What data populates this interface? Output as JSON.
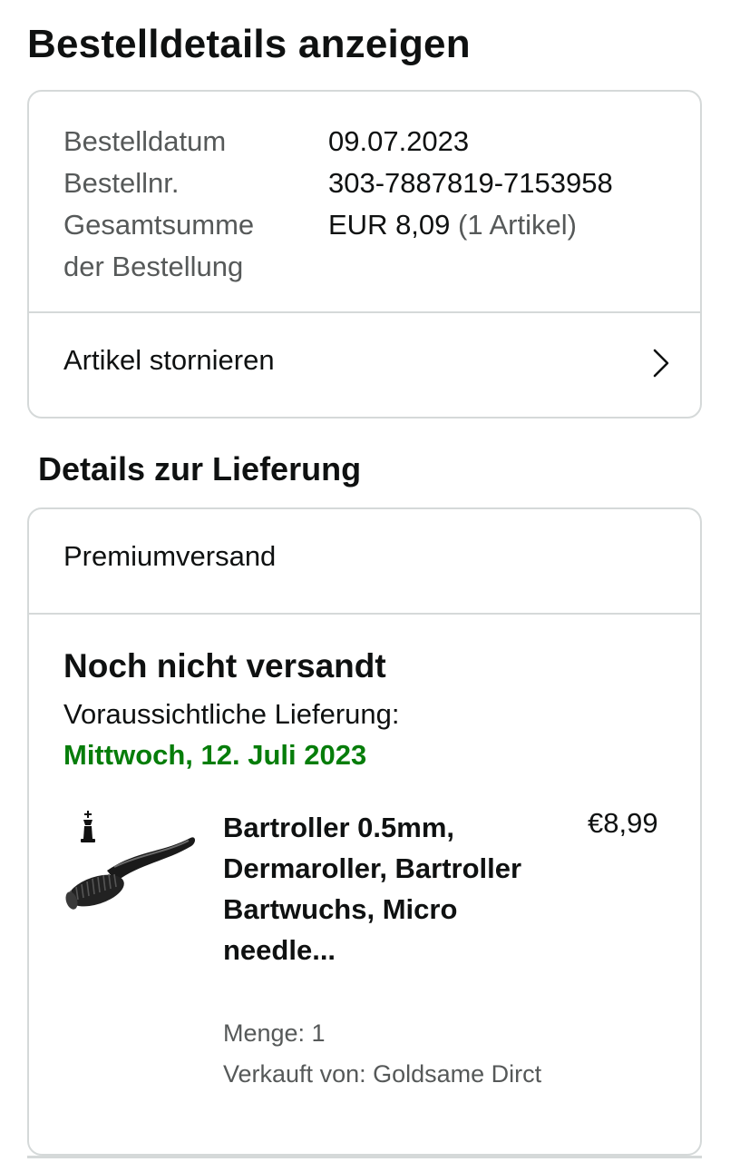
{
  "page": {
    "title": "Bestelldetails anzeigen"
  },
  "order": {
    "date_label": "Bestelldatum",
    "date_value": "09.07.2023",
    "number_label": "Bestellnr.",
    "number_value": "303-7887819-7153958",
    "total_label_line1": "Gesamtsumme",
    "total_label_line2": "der Bestellung",
    "total_value": "EUR 8,09",
    "total_items": "(1 Artikel)",
    "cancel_label": "Artikel stornieren",
    "cancel_icon": "chevron-right-icon"
  },
  "delivery": {
    "section_title": "Details zur Lieferung",
    "shipping_method": "Premiumversand",
    "status": "Noch nicht versandt",
    "eta_label": "Voraussichtliche Lieferung:",
    "eta_date": "Mittwoch, 12. Juli 2023",
    "eta_color": "#067d0a"
  },
  "product": {
    "title": "Bartroller 0.5mm, Dermaroller, Bartroller Bartwuchs, Micro needle...",
    "price": "€8,99",
    "quantity": "Menge: 1",
    "seller": "Verkauft von: Goldsame Dirct",
    "image_icon": "derma-roller-image"
  }
}
